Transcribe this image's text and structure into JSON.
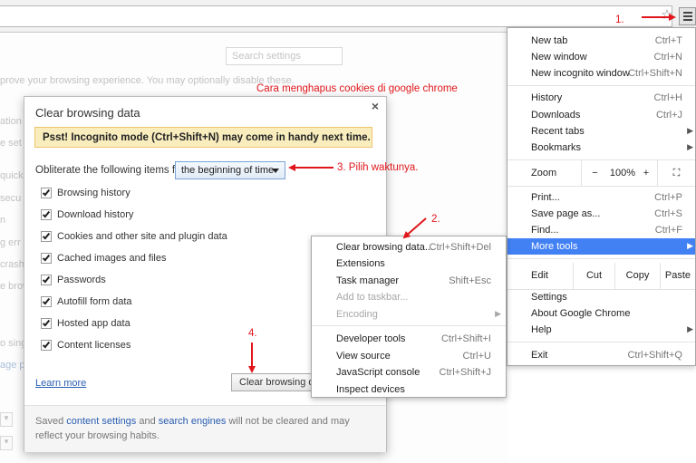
{
  "toolbar": {},
  "settings": {
    "search_placeholder": "Search settings",
    "bg_lines": [
      {
        "text": "prove your browsing experience. You may optionally disable these."
      },
      {
        "text": "ation"
      },
      {
        "text": "e set"
      },
      {
        "text": "quick"
      },
      {
        "text": "secu"
      },
      {
        "text": "n"
      },
      {
        "text": "g err"
      },
      {
        "text": "crash"
      },
      {
        "text": "e brow"
      },
      {
        "text": "o singl"
      },
      {
        "text": "age p"
      }
    ]
  },
  "caption": "Cara menghapus cookies di google chrome",
  "annotations": {
    "step1": "1.",
    "step2": "2.",
    "step3": "3. Pilih waktunya.",
    "step4": "4."
  },
  "dialog": {
    "title": "Clear browsing data",
    "close": "×",
    "hint": "Psst! Incognito mode (Ctrl+Shift+N) may come in handy next time.",
    "obliterate_label": "Obliterate the following items from:",
    "obliterate_value": "the beginning of time",
    "options": [
      {
        "label": "Browsing history",
        "checked": true
      },
      {
        "label": "Download history",
        "checked": true
      },
      {
        "label": "Cookies and other site and plugin data",
        "checked": true
      },
      {
        "label": "Cached images and files",
        "checked": true
      },
      {
        "label": "Passwords",
        "checked": true
      },
      {
        "label": "Autofill form data",
        "checked": true
      },
      {
        "label": "Hosted app data",
        "checked": true
      },
      {
        "label": "Content licenses",
        "checked": true
      }
    ],
    "learn_more": "Learn more",
    "clear_button": "Clear browsing data",
    "footer": {
      "t1": "Saved ",
      "link1": "content settings",
      "t2": " and ",
      "link2": "search engines",
      "t3": " will not be cleared and may reflect your browsing habits."
    }
  },
  "menu": {
    "new_tab": {
      "label": "New tab",
      "shortcut": "Ctrl+T"
    },
    "new_window": {
      "label": "New window",
      "shortcut": "Ctrl+N"
    },
    "new_incognito": {
      "label": "New incognito window",
      "shortcut": "Ctrl+Shift+N"
    },
    "history": {
      "label": "History",
      "shortcut": "Ctrl+H"
    },
    "downloads": {
      "label": "Downloads",
      "shortcut": "Ctrl+J"
    },
    "recent_tabs": {
      "label": "Recent tabs"
    },
    "bookmarks": {
      "label": "Bookmarks"
    },
    "zoom": {
      "label": "Zoom",
      "minus": "−",
      "value": "100%",
      "plus": "+",
      "fullscreen": "⛶"
    },
    "print": {
      "label": "Print...",
      "shortcut": "Ctrl+P"
    },
    "save_page": {
      "label": "Save page as...",
      "shortcut": "Ctrl+S"
    },
    "find": {
      "label": "Find...",
      "shortcut": "Ctrl+F"
    },
    "more_tools": {
      "label": "More tools"
    },
    "edit": {
      "label": "Edit",
      "cut": "Cut",
      "copy": "Copy",
      "paste": "Paste"
    },
    "settings": {
      "label": "Settings"
    },
    "about": {
      "label": "About Google Chrome"
    },
    "help": {
      "label": "Help"
    },
    "exit": {
      "label": "Exit",
      "shortcut": "Ctrl+Shift+Q"
    },
    "submenu_arrow": "▶"
  },
  "submenu": {
    "clear_data": {
      "label": "Clear browsing data...",
      "shortcut": "Ctrl+Shift+Del"
    },
    "extensions": {
      "label": "Extensions"
    },
    "task_manager": {
      "label": "Task manager",
      "shortcut": "Shift+Esc"
    },
    "add_taskbar": {
      "label": "Add to taskbar..."
    },
    "encoding": {
      "label": "Encoding"
    },
    "dev_tools": {
      "label": "Developer tools",
      "shortcut": "Ctrl+Shift+I"
    },
    "view_source": {
      "label": "View source",
      "shortcut": "Ctrl+U"
    },
    "js_console": {
      "label": "JavaScript console",
      "shortcut": "Ctrl+Shift+J"
    },
    "inspect": {
      "label": "Inspect devices"
    }
  },
  "colors": {
    "annotation_red": "#e0161b",
    "highlight_blue": "#4281f4",
    "hint_yellow": "#f9edbe",
    "link_blue": "#2a5db0"
  }
}
